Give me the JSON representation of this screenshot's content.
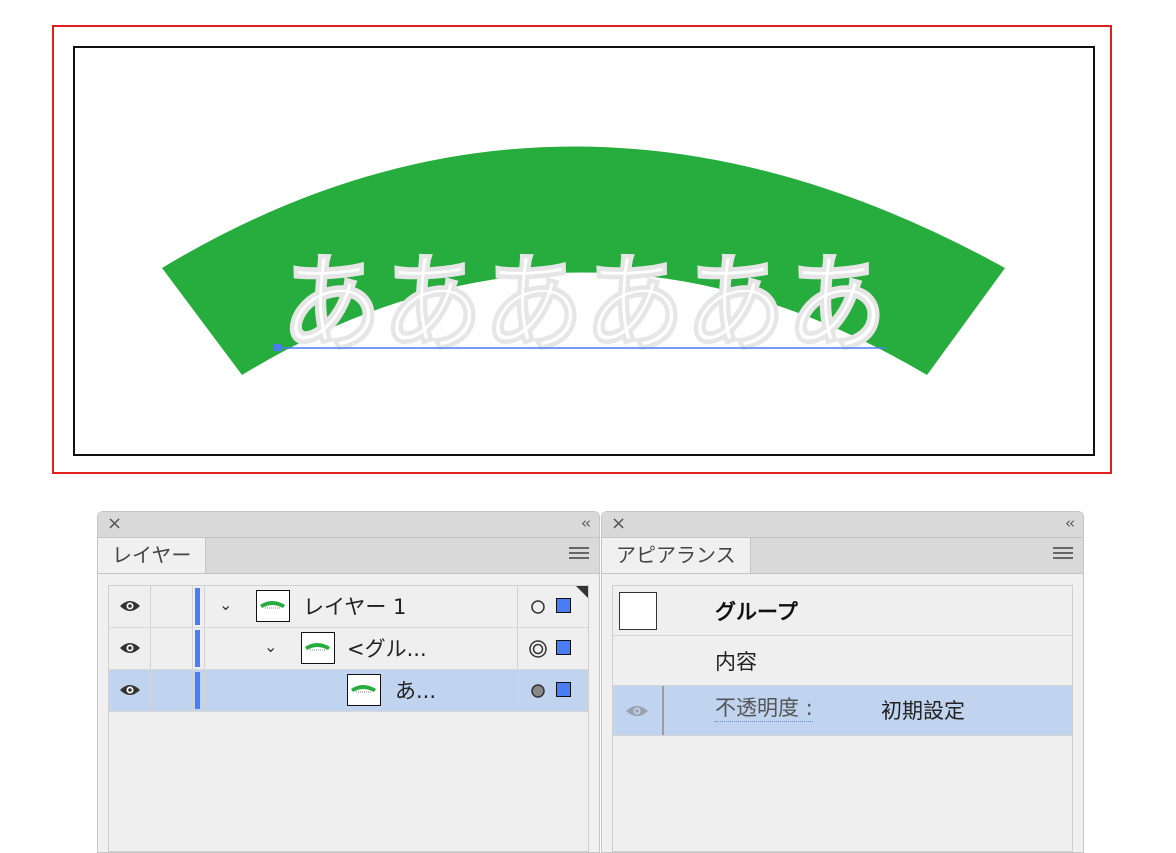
{
  "artboard": {
    "glyph_text": "ああああああ",
    "arc_color": "#27ac3e",
    "guide_color": "#4a7cf5"
  },
  "layers_panel": {
    "close_icon": "×",
    "collapse_icon": "‹‹",
    "tab_label": "レイヤー",
    "rows": [
      {
        "label": "レイヤー 1",
        "chevron": "⌄",
        "target": "circle",
        "selected": false
      },
      {
        "label": "<グル...",
        "chevron": "⌄",
        "target": "double-circle",
        "selected": false
      },
      {
        "label": "あ...",
        "chevron": "",
        "target": "filled-circle",
        "selected": true
      }
    ],
    "layer_color": "#4a7cf5"
  },
  "appearance_panel": {
    "close_icon": "×",
    "collapse_icon": "‹‹",
    "tab_label": "アピアランス",
    "title": "グループ",
    "contents_label": "内容",
    "opacity_label": "不透明度 :",
    "opacity_value": "初期設定"
  }
}
